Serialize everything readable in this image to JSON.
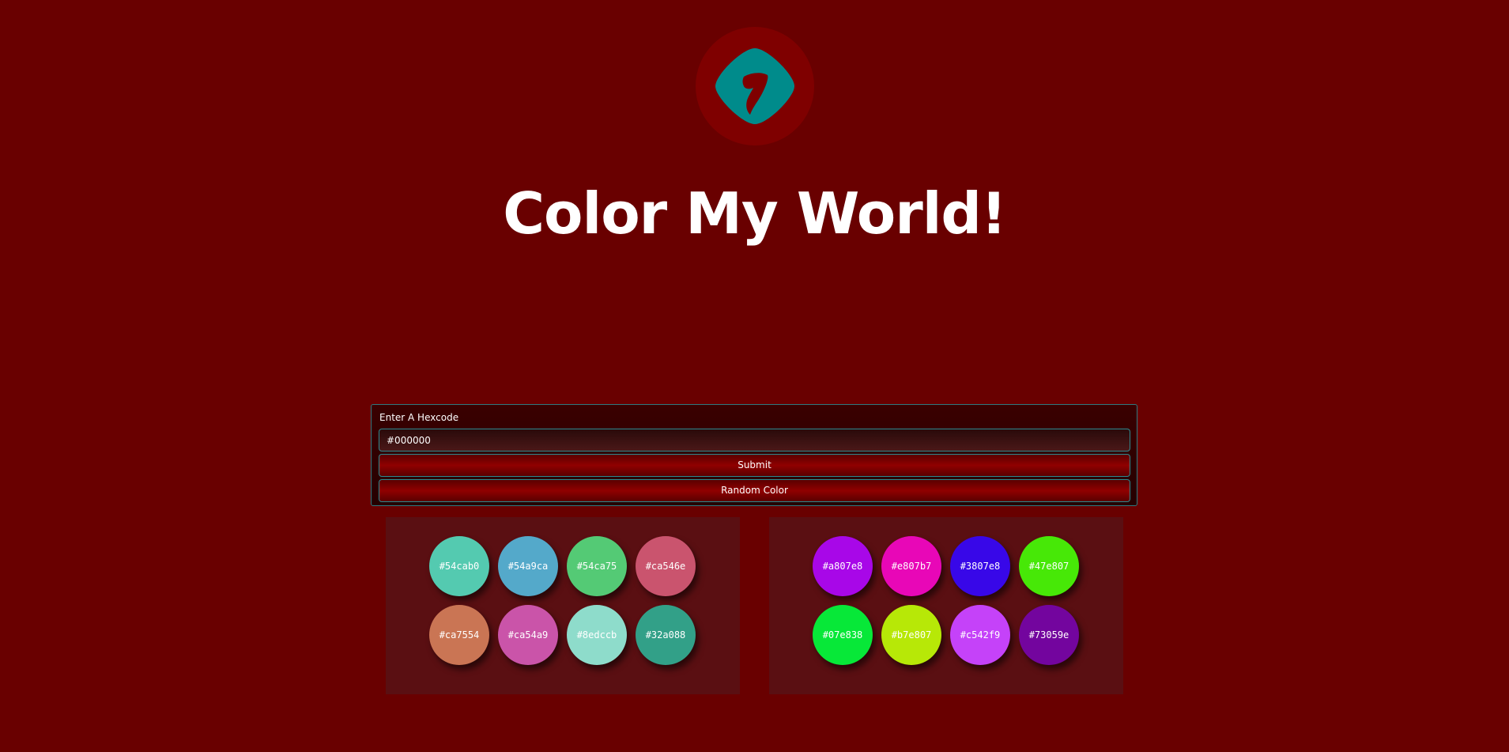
{
  "header": {
    "title": "Color My World!",
    "logo_icon": "logo-icon",
    "logo_bg": "#7f0000",
    "logo_fg": "#008b8b"
  },
  "form": {
    "label": "Enter A Hexcode",
    "input_value": "#000000",
    "submit_label": "Submit",
    "random_label": "Random Color"
  },
  "palette_left": {
    "swatches": [
      {
        "label": "#54cab0",
        "color": "#54cab0"
      },
      {
        "label": "#54a9ca",
        "color": "#54a9ca"
      },
      {
        "label": "#54ca75",
        "color": "#54ca75"
      },
      {
        "label": "#ca546e",
        "color": "#ca546e"
      },
      {
        "label": "#ca7554",
        "color": "#ca7554"
      },
      {
        "label": "#ca54a9",
        "color": "#ca54a9"
      },
      {
        "label": "#8edccb",
        "color": "#8edccb"
      },
      {
        "label": "#32a088",
        "color": "#32a088"
      }
    ]
  },
  "palette_right": {
    "swatches": [
      {
        "label": "#a807e8",
        "color": "#a807e8"
      },
      {
        "label": "#e807b7",
        "color": "#e807b7"
      },
      {
        "label": "#3807e8",
        "color": "#3807e8"
      },
      {
        "label": "#47e807",
        "color": "#47e807"
      },
      {
        "label": "#07e838",
        "color": "#07e838"
      },
      {
        "label": "#b7e807",
        "color": "#b7e807"
      },
      {
        "label": "#c542f9",
        "color": "#c542f9"
      },
      {
        "label": "#73059e",
        "color": "#73059e"
      }
    ]
  },
  "colors": {
    "background": "#690000",
    "panel_border": "#2f8a8f",
    "palette_bg": "#5a0f12"
  }
}
